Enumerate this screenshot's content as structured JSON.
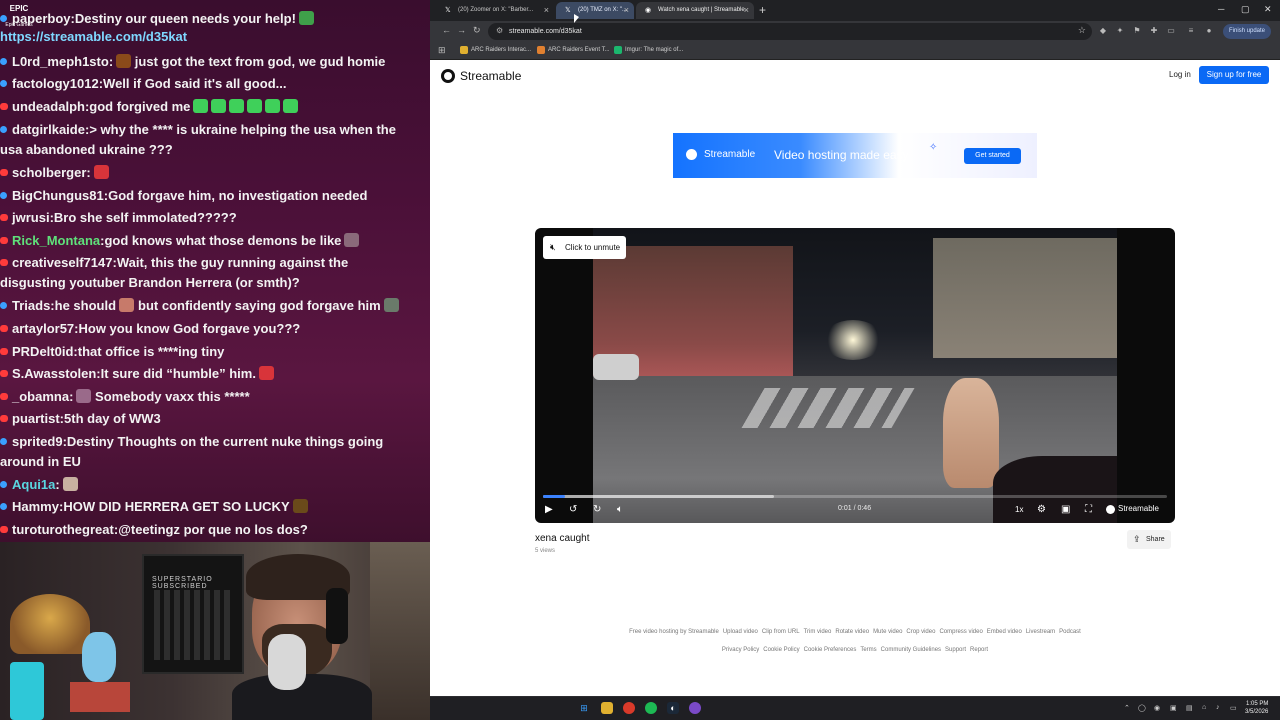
{
  "chat": {
    "top_logo": "EPIC",
    "top_logo_sub": "Epic Games",
    "messages": [
      {
        "user": "paperboy",
        "text": "Destiny our queen needs your help!",
        "badge": "blue",
        "emote": "#3fa04a"
      },
      {
        "user": "L0rd_meph1sto",
        "text": "just got the text from god, we gud homie",
        "badge": "blue",
        "emote_pre": "#8a4a1a"
      },
      {
        "user": "factology1012",
        "text": "Well if God said it's all good...",
        "badge": "blue"
      },
      {
        "user": "undeadalph",
        "text": "god forgived me",
        "badge": "red",
        "emotes_green": 6
      },
      {
        "user": "datgirlkaide",
        "text": "> why the **** is ukraine helping the usa when the",
        "badge": "blue",
        "cont": "usa abandoned ukraine ???"
      },
      {
        "user": "scholberger",
        "text": "",
        "badge": "red",
        "emote": "#d8343a"
      },
      {
        "user": "BigChungus81",
        "text": "God forgave him, no investigation needed",
        "badge": "blue"
      },
      {
        "user": "jwrusi",
        "text": "Bro she self immolated?????",
        "badge": "red"
      },
      {
        "user": "Rick_Montana",
        "text": "god knows what those demons be like",
        "badge": "red",
        "user_color": "green",
        "emote": "#8a6a7a"
      },
      {
        "user": "creativeself7147",
        "text": "Wait, this the guy running against the",
        "badge": "red",
        "cont": "disgusting youtuber Brandon Herrera (or smth)?"
      },
      {
        "user": "Triads",
        "text": "he should",
        "badge": "blue",
        "emote": "#c77a6a",
        "tail": "but confidently saying god forgave him",
        "emote2": "#6a7a6a"
      },
      {
        "user": "artaylor57",
        "text": "How you know God forgave you???",
        "badge": "red"
      },
      {
        "user": "PRDelt0id",
        "text": "that office is ****ing tiny",
        "badge": "red"
      },
      {
        "user": "S.Awasstolen",
        "text": "It sure did “humble” him.",
        "badge": "red",
        "emote": "#d8343a"
      },
      {
        "user": "_obamna",
        "text": "Somebody vaxx this *****",
        "badge": "red",
        "emote_pre": "#9a6a8a"
      },
      {
        "user": "puartist",
        "text": "5th day of WW3",
        "badge": "red"
      },
      {
        "user": "sprited9",
        "text": "Destiny Thoughts on the current nuke things going",
        "badge": "blue",
        "cont": "around in EU"
      },
      {
        "user": "Aqui1a",
        "text": "",
        "badge": "blue",
        "user_color": "cyan",
        "emote": "#c8b0a0"
      },
      {
        "user": "Hammy",
        "text": "HOW DID HERRERA GET SO LUCKY",
        "badge": "blue",
        "emote": "#6a4a1a"
      },
      {
        "user": "turoturothegreat",
        "text": "@teetingz por que no los dos?",
        "badge": "red"
      }
    ],
    "link": "https://streamable.com/d35kat"
  },
  "webcam": {
    "poster_text": "SUPERSTARIO SUBSCRIBED"
  },
  "browser": {
    "tabs": [
      {
        "label": "(20) Zoomer on X: \"Barber...",
        "icon": "X"
      },
      {
        "label": "(20) TMZ on X: \"...",
        "icon": "X"
      },
      {
        "label": "Watch xena caught | Streamable",
        "icon": "S"
      }
    ],
    "new_tab": "+",
    "url": "streamable.com/d35kat",
    "finish_update": "Finish update",
    "bookmarks": [
      {
        "label": "ARC Raiders Interac...",
        "color": "#e0b030"
      },
      {
        "label": "ARC Raiders Event T...",
        "color": "#e08030"
      },
      {
        "label": "Imgur: The magic of...",
        "color": "#1bb76e"
      }
    ]
  },
  "page": {
    "brand": "Streamable",
    "login": "Log in",
    "signup": "Sign up for free",
    "banner": {
      "brand": "Streamable",
      "tagline": "Video hosting made easy",
      "cta": "Get started"
    },
    "player": {
      "unmute": "Click to unmute",
      "timecode": "0:01 / 0:46",
      "speed": "1x",
      "brand": "Streamable",
      "played_fraction": 0.035,
      "buffered_fraction": 0.37
    },
    "video_title": "xena caught",
    "views": "5 views",
    "share": "Share",
    "footer_row1": [
      "Free video hosting by Streamable",
      "Upload video",
      "Clip from URL",
      "Trim video",
      "Rotate video",
      "Mute video",
      "Crop video",
      "Compress video",
      "Embed video",
      "Livestream",
      "Podcast"
    ],
    "footer_row2": [
      "Privacy Policy",
      "Cookie Policy",
      "Cookie Preferences",
      "Terms",
      "Community Guidelines",
      "Support",
      "Report"
    ]
  },
  "taskbar": {
    "time": "1:05 PM",
    "date": "3/5/2026"
  }
}
